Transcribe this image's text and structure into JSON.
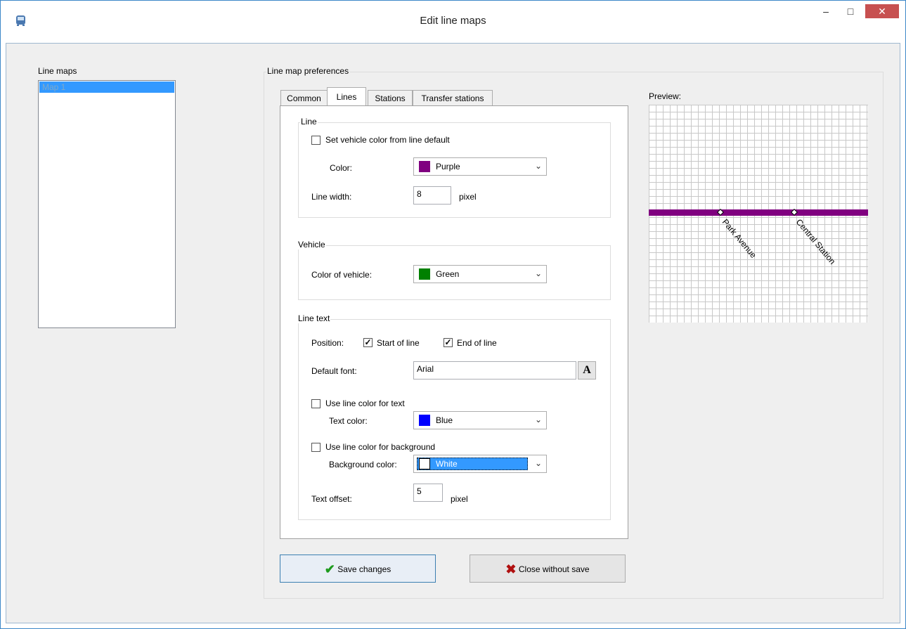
{
  "window": {
    "title": "Edit line maps",
    "minimize": "–",
    "maximize": "□",
    "close": "✕"
  },
  "line_maps": {
    "label": "Line maps",
    "items": [
      "Map 1"
    ]
  },
  "prefs": {
    "title": "Line map preferences"
  },
  "tabs": [
    "Common",
    "Lines",
    "Stations",
    "Transfer stations"
  ],
  "line_group": {
    "title": "Line",
    "set_vehicle_color": {
      "label": "Set vehicle color from line default",
      "checked": false
    },
    "color_label": "Color:",
    "color": {
      "name": "Purple",
      "swatch": "#800080"
    },
    "line_width_label": "Line width:",
    "line_width": "8",
    "pixel": "pixel"
  },
  "vehicle_group": {
    "title": "Vehicle",
    "color_label": "Color of vehicle:",
    "color": {
      "name": "Green",
      "swatch": "#008000"
    }
  },
  "line_text_group": {
    "title": "Line text",
    "position_label": "Position:",
    "start_of_line": {
      "label": "Start of line",
      "checked": true
    },
    "end_of_line": {
      "label": "End of line",
      "checked": true
    },
    "default_font_label": "Default font:",
    "default_font": "Arial",
    "font_button": "A",
    "use_line_color_text": {
      "label": "Use line color for text",
      "checked": false
    },
    "text_color_label": "Text color:",
    "text_color": {
      "name": "Blue",
      "swatch": "#0000ff"
    },
    "use_line_color_bg": {
      "label": "Use line color for background",
      "checked": false
    },
    "bg_color_label": "Background color:",
    "bg_color": {
      "name": "White",
      "swatch": "#ffffff"
    },
    "text_offset_label": "Text offset:",
    "text_offset": "5",
    "pixel": "pixel"
  },
  "preview": {
    "label": "Preview:",
    "line_color": "#800080",
    "stations": [
      "Park Avenue",
      "Central Station"
    ]
  },
  "buttons": {
    "save": "Save changes",
    "close": "Close without save"
  }
}
